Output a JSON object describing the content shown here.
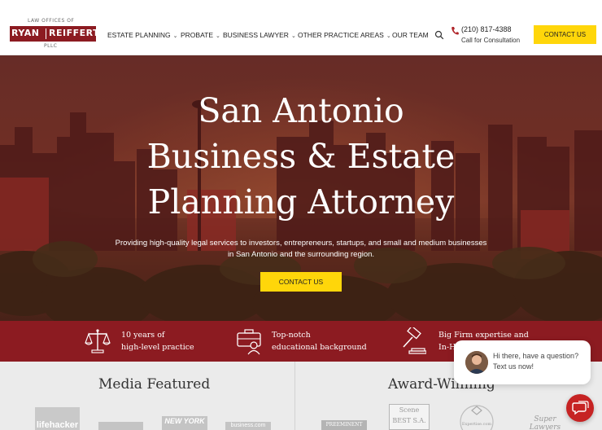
{
  "header": {
    "logo": {
      "top_text": "LAW OFFICES OF",
      "name_left": "RYAN",
      "name_right": "REIFFERT",
      "bottom_text": "PLLC"
    },
    "nav": [
      {
        "label": "ESTATE PLANNING",
        "has_dropdown": true
      },
      {
        "label": "PROBATE",
        "has_dropdown": true
      },
      {
        "label": "BUSINESS LAWYER",
        "has_dropdown": true
      },
      {
        "label": "OTHER PRACTICE AREAS",
        "has_dropdown": true
      },
      {
        "label": "OUR TEAM",
        "has_dropdown": false
      }
    ],
    "search_icon": "search-icon",
    "phone": "(210) 817-4388",
    "phone_caption": "Call for Consultation",
    "contact_label": "CONTACT US"
  },
  "hero": {
    "title_lines": [
      "San Antonio",
      "Business & Estate",
      "Planning Attorney"
    ],
    "subtitle": "Providing high-quality legal services to investors, entrepreneurs, startups, and small and medium businesses in San Antonio and the surrounding region.",
    "cta_label": "CONTACT US"
  },
  "features": [
    {
      "icon": "scales-of-justice-icon",
      "line1": "10 years of",
      "line2": "high-level practice"
    },
    {
      "icon": "briefcase-person-icon",
      "line1": "Top-notch",
      "line2": "educational background"
    },
    {
      "icon": "gavel-icon",
      "line1": "Big Firm expertise and",
      "line2": "In-H"
    }
  ],
  "bottom": {
    "media_title": "Media Featured",
    "media_logos": [
      "lifehacker",
      "",
      "NEW YORK",
      "business.com"
    ],
    "award_title": "Award-Winning",
    "awards": [
      "PREEMINENT",
      "Scene BEST S.A.",
      "Expertise.com",
      "Super Lawyers"
    ]
  },
  "chat": {
    "message": "Hi there, have a question? Text us now!",
    "icon": "chat-icon"
  },
  "colors": {
    "brand_red": "#8c1b21",
    "accent_yellow": "#ffd60a",
    "chat_red": "#c62323"
  }
}
